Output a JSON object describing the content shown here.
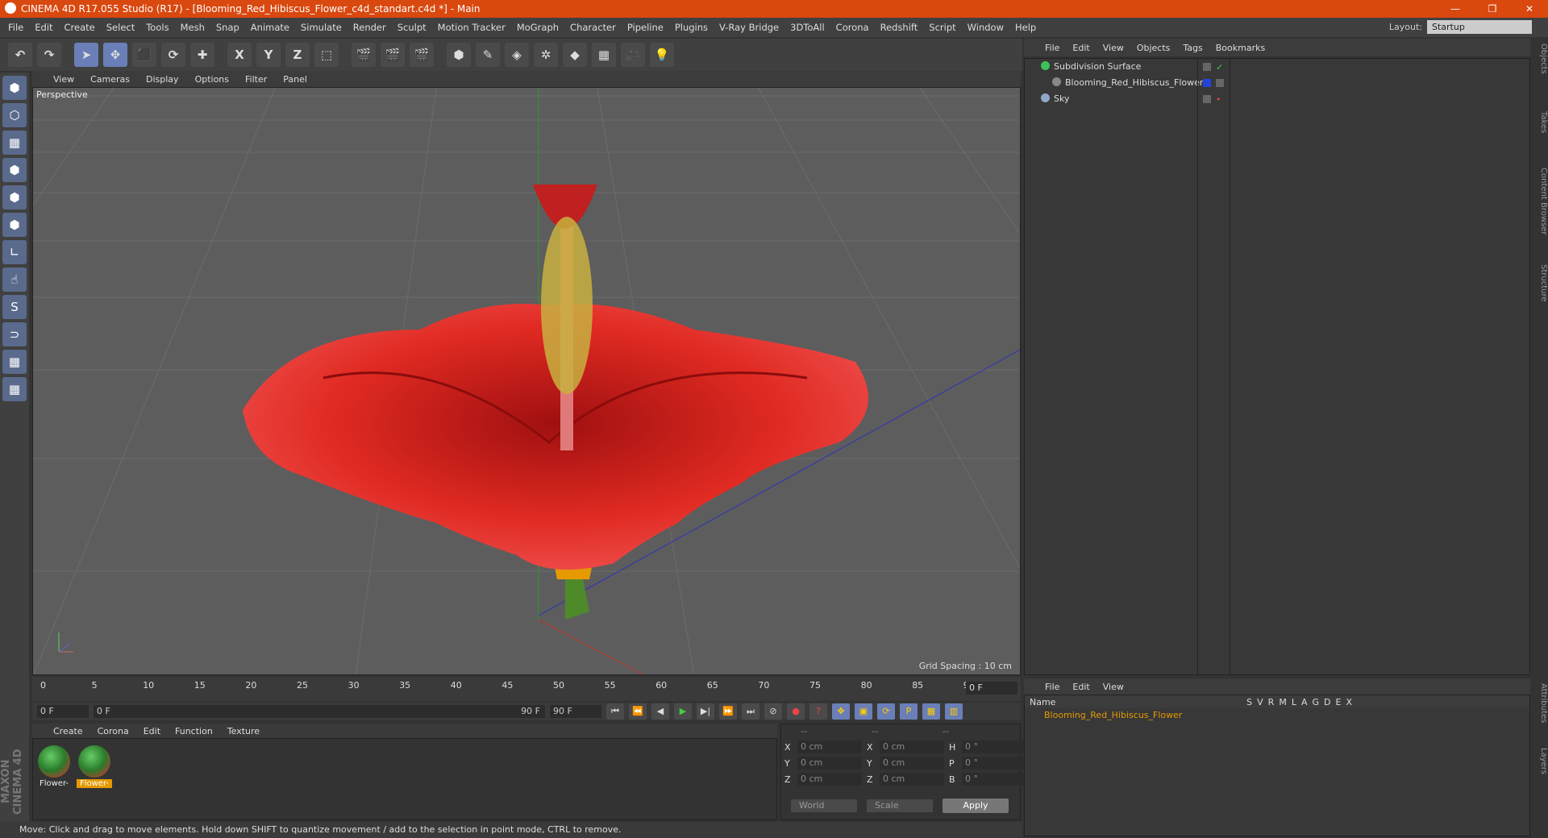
{
  "window": {
    "title": "CINEMA 4D R17.055 Studio (R17) - [Blooming_Red_Hibiscus_Flower_c4d_standart.c4d *] - Main",
    "controls": [
      "—",
      "❐",
      "✕"
    ]
  },
  "menubar": {
    "items": [
      "File",
      "Edit",
      "Create",
      "Select",
      "Tools",
      "Mesh",
      "Snap",
      "Animate",
      "Simulate",
      "Render",
      "Sculpt",
      "Motion Tracker",
      "MoGraph",
      "Character",
      "Pipeline",
      "Plugins",
      "V-Ray Bridge",
      "3DToAll",
      "Corona",
      "Redshift",
      "Script",
      "Window",
      "Help"
    ],
    "layout_label": "Layout:",
    "layout_value": "Startup"
  },
  "toolbar": {
    "buttons": [
      {
        "name": "undo-button",
        "glyph": "↶"
      },
      {
        "name": "redo-button",
        "glyph": "↷"
      },
      {
        "name": "select-tool-button",
        "glyph": "➤"
      },
      {
        "name": "move-tool-button",
        "glyph": "✥"
      },
      {
        "name": "scale-tool-button",
        "glyph": "⬛"
      },
      {
        "name": "rotate-tool-button",
        "glyph": "⟳"
      },
      {
        "name": "live-move-button",
        "glyph": "✚"
      },
      {
        "name": "x-axis-button",
        "glyph": "X"
      },
      {
        "name": "y-axis-button",
        "glyph": "Y"
      },
      {
        "name": "z-axis-button",
        "glyph": "Z"
      },
      {
        "name": "coordinate-system-button",
        "glyph": "⬚"
      },
      {
        "name": "render-view-button",
        "glyph": "🎬"
      },
      {
        "name": "render-picture-viewer-button",
        "glyph": "🎬"
      },
      {
        "name": "render-settings-button",
        "glyph": "🎬"
      },
      {
        "name": "cube-object-button",
        "glyph": "⬢"
      },
      {
        "name": "spline-pen-button",
        "glyph": "✎"
      },
      {
        "name": "subdivision-button",
        "glyph": "◈"
      },
      {
        "name": "mograph-cloner-button",
        "glyph": "✲"
      },
      {
        "name": "deformer-button",
        "glyph": "◆"
      },
      {
        "name": "floor-button",
        "glyph": "▦"
      },
      {
        "name": "camera-button",
        "glyph": "🎥"
      },
      {
        "name": "light-button",
        "glyph": "💡"
      }
    ]
  },
  "left_tools": [
    "⬢",
    "⬡",
    "▦",
    "⬢",
    "⬢",
    "⬢",
    "∟",
    "☝",
    "S",
    "⊃",
    "▦",
    "▦"
  ],
  "viewport": {
    "menu": [
      "View",
      "Cameras",
      "Display",
      "Options",
      "Filter",
      "Panel"
    ],
    "label": "Perspective",
    "grid_spacing": "Grid Spacing : 10 cm",
    "nav_icons": "✥ ⇕ ⟳ ⬚"
  },
  "timeline": {
    "ticks": [
      "0",
      "5",
      "10",
      "15",
      "20",
      "25",
      "30",
      "35",
      "40",
      "45",
      "50",
      "55",
      "60",
      "65",
      "70",
      "75",
      "80",
      "85",
      "90"
    ],
    "current_frame": "0 F"
  },
  "playbar": {
    "start": "0 F",
    "range_start": "0 F",
    "range_end": "90 F",
    "end": "90 F"
  },
  "materials": {
    "menu": [
      "Create",
      "Corona",
      "Edit",
      "Function",
      "Texture"
    ],
    "items": [
      {
        "name": "Flower-",
        "selected": false
      },
      {
        "name": "Flower-",
        "selected": true
      }
    ]
  },
  "coords": {
    "header": [
      "--",
      "--",
      "--"
    ],
    "rows": [
      {
        "a": "X",
        "av": "0 cm",
        "b": "X",
        "bv": "0 cm",
        "c": "H",
        "cv": "0 °"
      },
      {
        "a": "Y",
        "av": "0 cm",
        "b": "Y",
        "bv": "0 cm",
        "c": "P",
        "cv": "0 °"
      },
      {
        "a": "Z",
        "av": "0 cm",
        "b": "Z",
        "bv": "0 cm",
        "c": "B",
        "cv": "0 °"
      }
    ],
    "world": "World",
    "scale": "Scale",
    "apply": "Apply"
  },
  "objects": {
    "menu": [
      "File",
      "Edit",
      "View",
      "Objects",
      "Tags",
      "Bookmarks"
    ],
    "items": [
      {
        "label": "Subdivision Surface",
        "color": "#3cc25a"
      },
      {
        "label": "Blooming_Red_Hibiscus_Flower",
        "color": "#888888"
      },
      {
        "label": "Sky",
        "color": "#8fa8c8"
      }
    ]
  },
  "layers": {
    "menu": [
      "File",
      "Edit",
      "View"
    ],
    "header_name": "Name",
    "header_cols": [
      "S",
      "V",
      "R",
      "M",
      "L",
      "A",
      "G",
      "D",
      "E",
      "X"
    ],
    "row": "Blooming_Red_Hibiscus_Flower"
  },
  "right_tabs": [
    "Objects",
    "Takes",
    "Content Browser",
    "Structure",
    "Attributes",
    "Layers"
  ],
  "maxon": "MAXON CINEMA 4D",
  "status": "Move: Click and drag to move elements. Hold down SHIFT to quantize movement / add to the selection in point mode, CTRL to remove.",
  "colors": {
    "titlebar": "#d9480f",
    "accent": "#e69a00",
    "flower": "#d8271f"
  }
}
